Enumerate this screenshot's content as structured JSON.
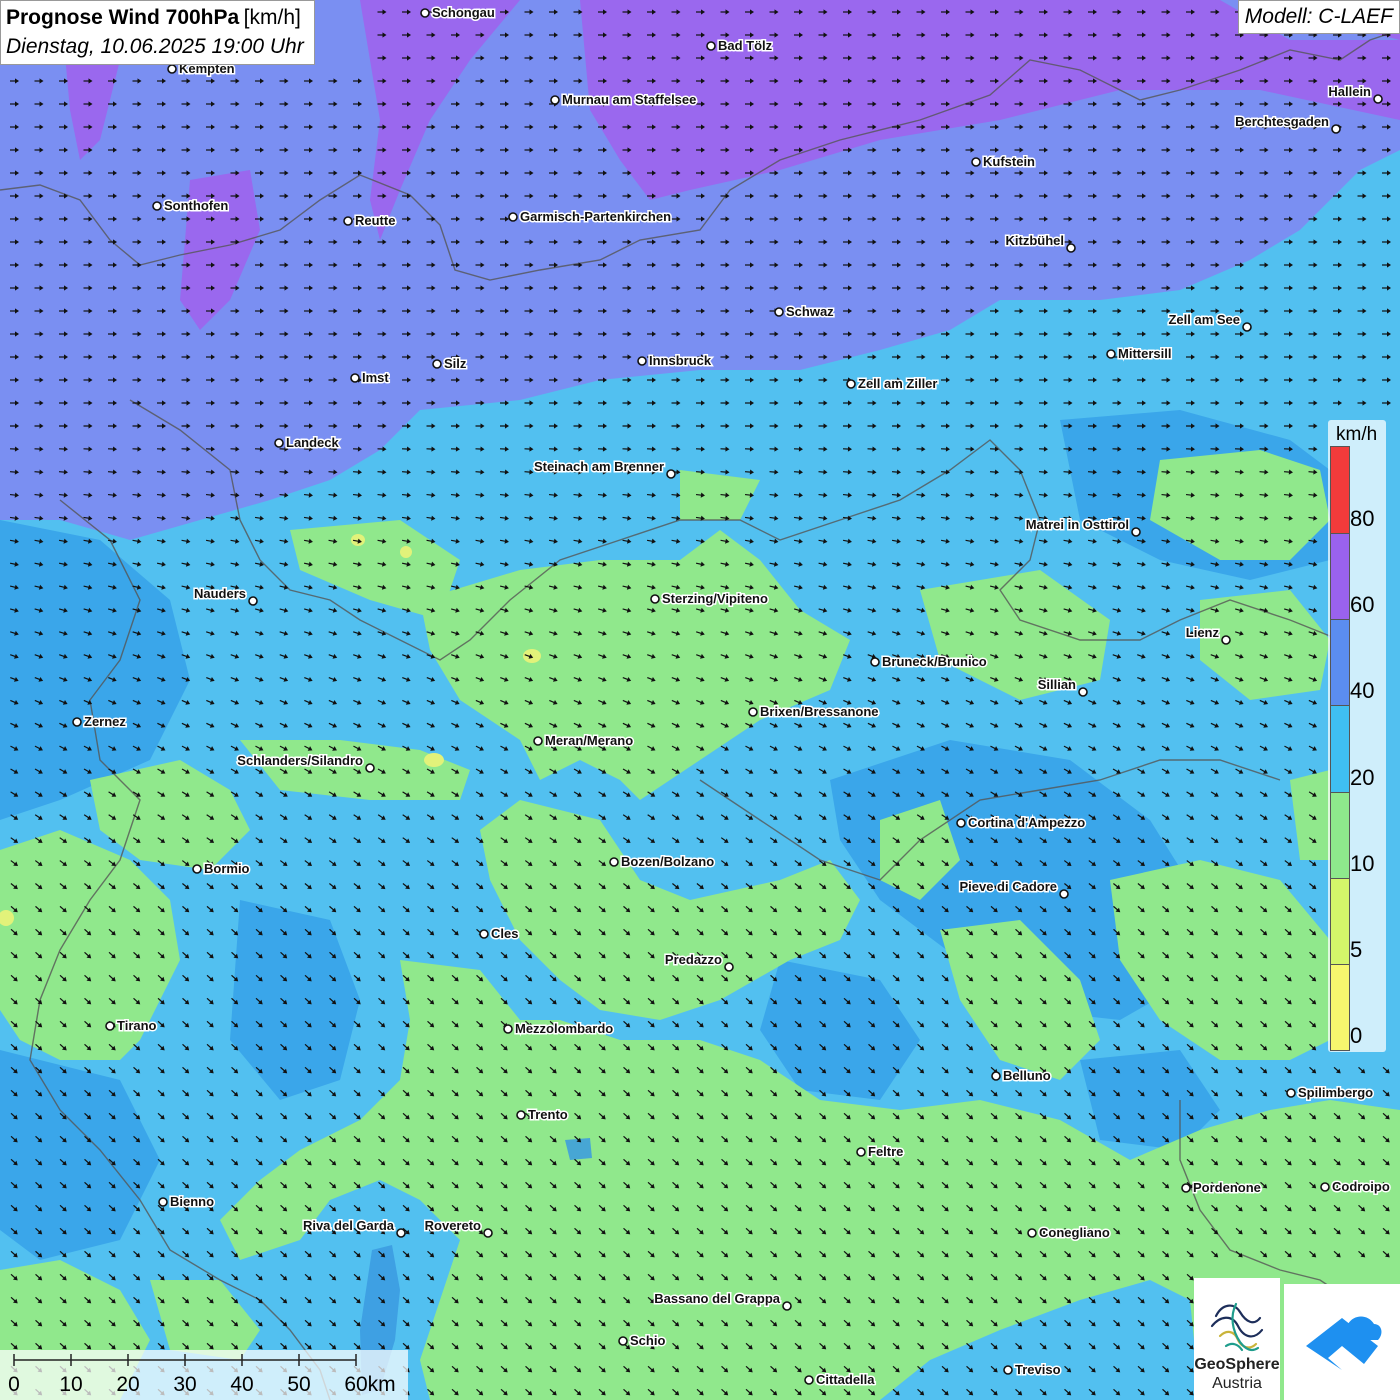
{
  "title": {
    "main": "Prognose Wind 700hPa",
    "unit": "[km/h]",
    "date": "Dienstag, 10.06.2025 19:00 Uhr"
  },
  "model": "Modell: C-LAEF",
  "legend": {
    "unit": "km/h",
    "bands": [
      {
        "from": 0,
        "to": 5,
        "color": "#f7f76e"
      },
      {
        "from": 5,
        "to": 10,
        "color": "#d4f56a"
      },
      {
        "from": 10,
        "to": 20,
        "color": "#8ee88c"
      },
      {
        "from": 20,
        "to": 40,
        "color": "#3fbff2"
      },
      {
        "from": 40,
        "to": 60,
        "color": "#5b8df0"
      },
      {
        "from": 60,
        "to": 80,
        "color": "#9a62ee"
      },
      {
        "from": 80,
        "to": null,
        "color": "#f23b3b"
      }
    ],
    "labels": [
      "0",
      "5",
      "10",
      "20",
      "40",
      "60",
      "80"
    ]
  },
  "scale_bar": {
    "labels": [
      "0",
      "10",
      "20",
      "30",
      "40",
      "50",
      "60km"
    ]
  },
  "logo": {
    "name_line1": "GeoSphere",
    "name_line2": "Austria"
  },
  "map_colors": {
    "calm_green": "#8ee88c",
    "light_blue": "#55c6f2",
    "mid_blue": "#3fb4ec",
    "blue_violet": "#7a8ff0",
    "violet": "#9a68ec",
    "border": "#555555"
  },
  "wind_direction": "from north-west, arrows pointing east in the north and south-east in the south",
  "cities": [
    {
      "name": "Schongau",
      "dot": "left"
    },
    {
      "name": "Bad Tölz",
      "dot": "left"
    },
    {
      "name": "Kempten",
      "dot": "left"
    },
    {
      "name": "Murnau am Staffelsee",
      "dot": "left"
    },
    {
      "name": "Hallein",
      "dot": "right"
    },
    {
      "name": "Berchtesgaden",
      "dot": "right"
    },
    {
      "name": "Kufstein",
      "dot": "left"
    },
    {
      "name": "Sonthofen",
      "dot": "left"
    },
    {
      "name": "Reutte",
      "dot": "left"
    },
    {
      "name": "Garmisch-Partenkirchen",
      "dot": "left"
    },
    {
      "name": "Kitzbühel",
      "dot": "right"
    },
    {
      "name": "Schwaz",
      "dot": "left"
    },
    {
      "name": "Zell am See",
      "dot": "right"
    },
    {
      "name": "Innsbruck",
      "dot": "left"
    },
    {
      "name": "Mittersill",
      "dot": "left"
    },
    {
      "name": "Imst",
      "dot": "left"
    },
    {
      "name": "Silz",
      "dot": "left"
    },
    {
      "name": "Zell am Ziller",
      "dot": "left"
    },
    {
      "name": "Landeck",
      "dot": "left"
    },
    {
      "name": "Steinach am Brenner",
      "dot": "right"
    },
    {
      "name": "Matrei in Osttirol",
      "dot": "right"
    },
    {
      "name": "Nauders",
      "dot": "right"
    },
    {
      "name": "Sterzing/Vipiteno",
      "dot": "left"
    },
    {
      "name": "Lienz",
      "dot": "right"
    },
    {
      "name": "Bruneck/Brunico",
      "dot": "left"
    },
    {
      "name": "Sillian",
      "dot": "right"
    },
    {
      "name": "Zernez",
      "dot": "left"
    },
    {
      "name": "Brixen/Bressanone",
      "dot": "left"
    },
    {
      "name": "Meran/Merano",
      "dot": "left"
    },
    {
      "name": "Schlanders/Silandro",
      "dot": "right"
    },
    {
      "name": "Cortina d'Ampezzo",
      "dot": "left"
    },
    {
      "name": "Bormio",
      "dot": "left"
    },
    {
      "name": "Bozen/Bolzano",
      "dot": "left"
    },
    {
      "name": "Pieve di Cadore",
      "dot": "right"
    },
    {
      "name": "Cles",
      "dot": "left"
    },
    {
      "name": "Predazzo",
      "dot": "right"
    },
    {
      "name": "Tirano",
      "dot": "left"
    },
    {
      "name": "Mezzolombardo",
      "dot": "left"
    },
    {
      "name": "Belluno",
      "dot": "left"
    },
    {
      "name": "Spilimbergo",
      "dot": "left"
    },
    {
      "name": "Trento",
      "dot": "left"
    },
    {
      "name": "Feltre",
      "dot": "left"
    },
    {
      "name": "Bienno",
      "dot": "left"
    },
    {
      "name": "Pordenone",
      "dot": "left"
    },
    {
      "name": "Codroipo",
      "dot": "left"
    },
    {
      "name": "Riva del Garda",
      "dot": "right"
    },
    {
      "name": "Rovereto",
      "dot": "right"
    },
    {
      "name": "Conegliano",
      "dot": "left"
    },
    {
      "name": "Bassano del Grappa",
      "dot": "right"
    },
    {
      "name": "Schio",
      "dot": "left"
    },
    {
      "name": "Treviso",
      "dot": "left"
    },
    {
      "name": "Cittadella",
      "dot": "left"
    }
  ]
}
